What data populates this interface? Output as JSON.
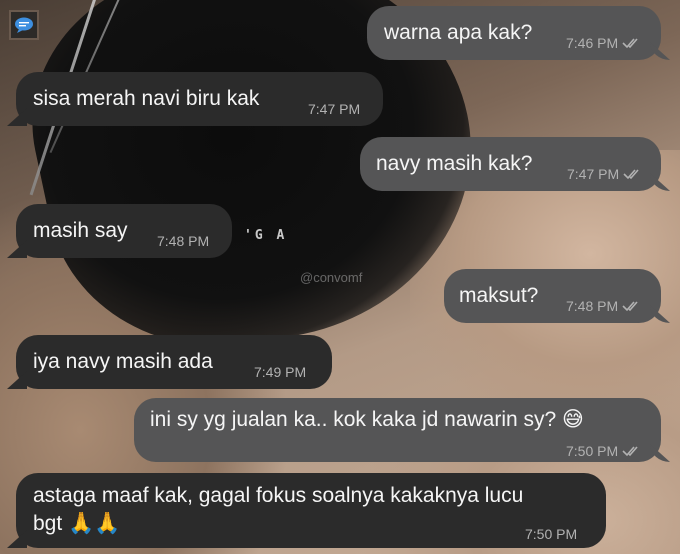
{
  "watermark": "@convomf",
  "background_print": "'G A",
  "messages": [
    {
      "dir": "out",
      "text": "warna apa kak?",
      "time": "7:46 PM",
      "read": true
    },
    {
      "dir": "in",
      "text": "sisa merah navi biru kak",
      "time": "7:47 PM"
    },
    {
      "dir": "out",
      "text": "navy masih kak?",
      "time": "7:47 PM",
      "read": true
    },
    {
      "dir": "in",
      "text": "masih say",
      "time": "7:48 PM"
    },
    {
      "dir": "out",
      "text": "maksut?",
      "time": "7:48 PM",
      "read": true
    },
    {
      "dir": "in",
      "text": "iya navy masih ada",
      "time": "7:49 PM"
    },
    {
      "dir": "out",
      "text": "ini sy yg jualan ka.. kok kaka jd nawarin sy? 😅",
      "time": "7:50 PM",
      "read": true
    },
    {
      "dir": "in",
      "line1": "astaga maaf kak, gagal fokus soalnya kakaknya lucu",
      "line2": "bgt 🙏🙏",
      "time": "7:50 PM"
    }
  ],
  "colors": {
    "incoming_bubble": "#2b2b2b",
    "outgoing_bubble": "#555556",
    "text": "#f5f5f5",
    "timestamp": "#b2b2b2"
  }
}
